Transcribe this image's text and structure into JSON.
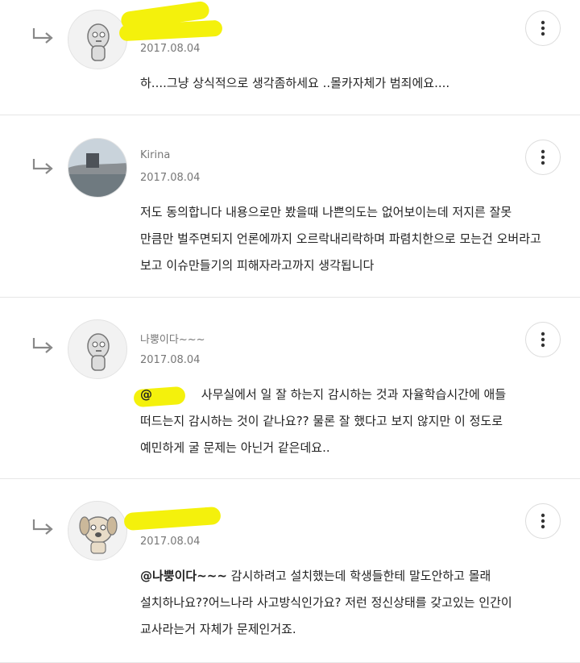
{
  "comments": [
    {
      "author": "",
      "date": "2017.08.04",
      "avatar": "character-icon",
      "lines": [
        "하....그냥 상식적으로 생각좀하세요 ..몰카자체가 범죄에요...."
      ]
    },
    {
      "author": "Kirina",
      "date": "2017.08.04",
      "avatar": "photo-landscape",
      "lines": [
        "저도 동의합니다 내용으로만 봤을때 나쁜의도는 없어보이는데 저지른 잘못",
        "만큼만 벌주면되지 언론에까지 오르락내리락하며 파렴치한으로 모는건 오버라고",
        "보고 이슈만들기의 피해자라고까지 생각됩니다"
      ]
    },
    {
      "author": "나뿡이다~~~",
      "date": "2017.08.04",
      "avatar": "character-icon",
      "mention": "@",
      "lines": [
        " 사무실에서 일 잘 하는지 감시하는 것과 자율학습시간에 애들",
        "떠드는지 감시하는 것이 같나요?? 물론 잘 했다고 보지 않지만 이 정도로",
        "예민하게 굴 문제는 아닌거 같은데요.."
      ]
    },
    {
      "author": "",
      "date": "2017.08.04",
      "avatar": "dog-character-icon",
      "mention": "@나뿡이다~~~",
      "lines": [
        "  감시하려고 설치했는데 학생들한테 말도안하고 몰래",
        "설치하나요??어느나라 사고방식인가요? 저런 정신상태를 갖고있는 인간이",
        "교사라는거 자체가 문제인거죠."
      ]
    }
  ],
  "colors": {
    "highlight": "#f4f10c",
    "divider": "#e6e6e6",
    "meta": "#777777"
  },
  "icons": {
    "reply": "reply-arrow-icon",
    "more": "more-vertical-icon"
  }
}
